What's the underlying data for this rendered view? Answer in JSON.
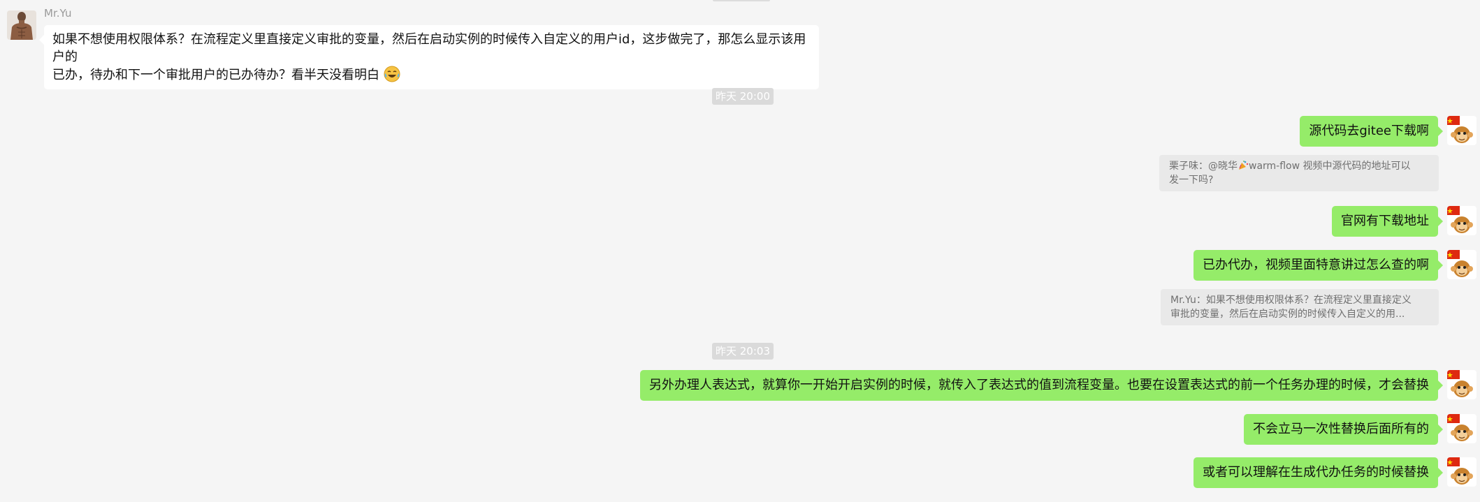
{
  "contact": {
    "name": "Mr.Yu",
    "avatar_icon": "muscle-man-avatar-icon"
  },
  "self": {
    "avatar_icon": "monkey-flag-avatar-icon"
  },
  "colors": {
    "background": "#f5f5f5",
    "incoming_bubble": "#ffffff",
    "outgoing_bubble": "#95ec69",
    "timestamp_bg": "#dadada",
    "quote_bg": "#e9e9e9"
  },
  "messages": [
    {
      "direction": "in",
      "line1": "如果不想使用权限体系？在流程定义里直接定义审批的变量，然后在启动实例的时候传入自定义的用户id，这步做完了，那怎么显示该用户的",
      "line2": "已办，待办和下一个审批用户的已办待办？看半天没看明白",
      "emoji": "laughing-tears-emoji"
    },
    {
      "type": "timestamp",
      "text": "昨天 20:00"
    },
    {
      "direction": "out",
      "text": "源代码去gitee下载啊"
    },
    {
      "type": "quote",
      "author": "栗子味：@晓华",
      "icon": "party-popper-icon",
      "line1": "warm-flow 视频中源代码的地址可以",
      "line2": "发一下吗?"
    },
    {
      "direction": "out",
      "text": "官网有下载地址"
    },
    {
      "direction": "out",
      "text": "已办代办，视频里面特意讲过怎么查的啊"
    },
    {
      "type": "quote",
      "line1": "Mr.Yu：如果不想使用权限体系？在流程定义里直接定义",
      "line2": "审批的变量，然后在启动实例的时候传入自定义的用..."
    },
    {
      "type": "timestamp",
      "text": "昨天 20:03"
    },
    {
      "direction": "out",
      "text": "另外办理人表达式，就算你一开始开启实例的时候，就传入了表达式的值到流程变量。也要在设置表达式的前一个任务办理的时候，才会替换"
    },
    {
      "direction": "out",
      "text": "不会立马一次性替换后面所有的"
    },
    {
      "direction": "out",
      "text": "或者可以理解在生成代办任务的时候替换"
    }
  ]
}
